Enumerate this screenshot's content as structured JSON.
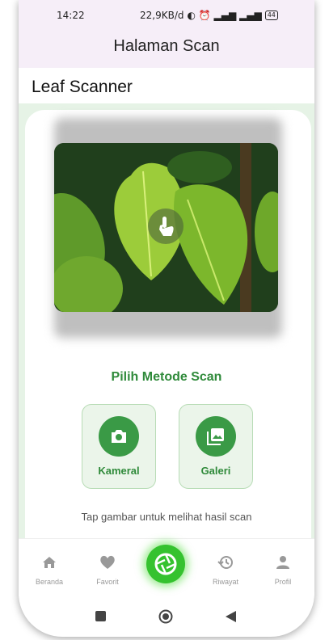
{
  "status_bar": {
    "time": "14:22",
    "network_speed": "22,9KB/d",
    "battery": "44"
  },
  "app_bar": {
    "title": "Halaman Scan"
  },
  "page": {
    "heading": "Leaf Scanner"
  },
  "scan_area": {
    "image_icon": "tap-hand-icon",
    "method_title": "Pilih Metode Scan",
    "methods": [
      {
        "label": "Kameral",
        "icon": "camera-icon"
      },
      {
        "label": "Galeri",
        "icon": "gallery-icon"
      }
    ],
    "hint": "Tap gambar untuk melihat hasil scan"
  },
  "bottom_nav": {
    "items": [
      {
        "label": "Beranda",
        "icon": "home-icon"
      },
      {
        "label": "Favorit",
        "icon": "heart-icon"
      },
      {
        "label": "",
        "icon": "scan-shutter-icon"
      },
      {
        "label": "Riwayat",
        "icon": "history-icon"
      },
      {
        "label": "Profil",
        "icon": "person-icon"
      }
    ]
  },
  "colors": {
    "accent_green": "#2f8a3a",
    "fab_green": "#35c22f",
    "app_bar_bg": "#f6eef8",
    "card_tint": "#e6f3e6"
  }
}
